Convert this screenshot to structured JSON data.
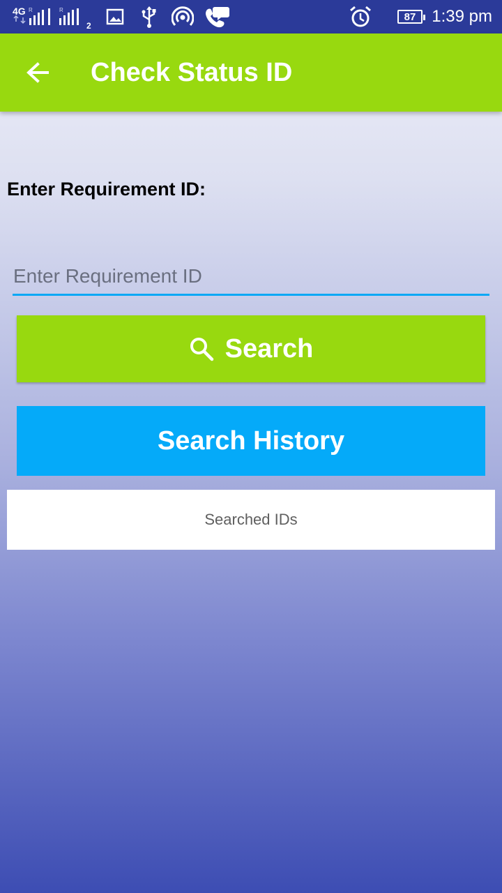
{
  "status_bar": {
    "network_label": "4G",
    "roaming_1": "R",
    "roaming_2": "R",
    "sim2_label": "2",
    "battery": "87",
    "time": "1:39 pm",
    "icons": [
      "signal-icon",
      "signal-2-icon",
      "image-icon",
      "usb-icon",
      "hotspot-icon",
      "call-message-icon",
      "alarm-icon",
      "battery-icon"
    ]
  },
  "app_bar": {
    "title": "Check Status ID",
    "back_icon": "arrow-back-icon",
    "color": "#98d90f"
  },
  "form": {
    "label": "Enter Requirement  ID:",
    "input_value": "",
    "input_placeholder": "Enter Requirement ID",
    "underline_color": "#08a8f5"
  },
  "buttons": {
    "search_label": "Search",
    "search_icon": "search-icon",
    "search_color": "#98d90f",
    "history_label": "Search History",
    "history_color": "#05aaf9"
  },
  "history": {
    "placeholder": "Searched IDs"
  }
}
